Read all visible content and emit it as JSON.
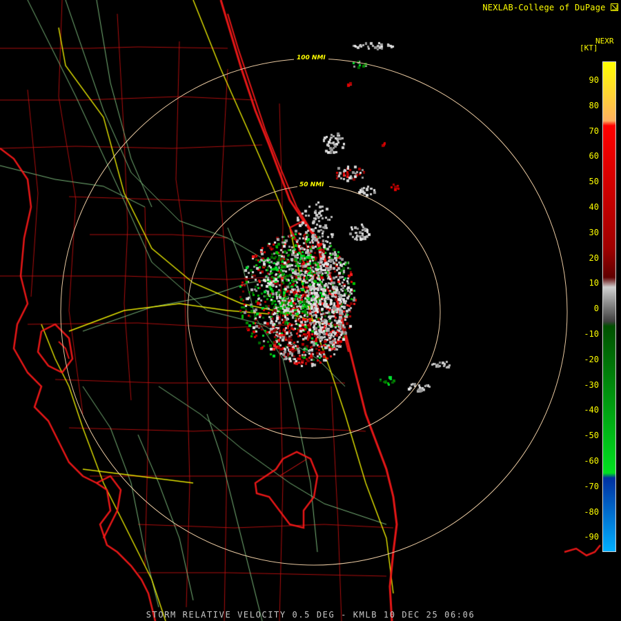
{
  "header": {
    "credit": "NEXLAB-College of DuPage",
    "logo_icon": "cod-logo-icon"
  },
  "legend": {
    "product_id": "NEXR",
    "unit": "[KT]",
    "ticks": [
      "90",
      "80",
      "70",
      "60",
      "50",
      "40",
      "30",
      "20",
      "10",
      "0",
      "-10",
      "-20",
      "-30",
      "-40",
      "-50",
      "-60",
      "-70",
      "-80",
      "-90"
    ],
    "gradient": [
      {
        "stop": 0.0,
        "color": "#ffff00"
      },
      {
        "stop": 0.12,
        "color": "#ffb060"
      },
      {
        "stop": 0.13,
        "color": "#ff0000"
      },
      {
        "stop": 0.38,
        "color": "#a00000"
      },
      {
        "stop": 0.44,
        "color": "#600000"
      },
      {
        "stop": 0.46,
        "color": "#d0d0d0"
      },
      {
        "stop": 0.53,
        "color": "#404040"
      },
      {
        "stop": 0.54,
        "color": "#005000"
      },
      {
        "stop": 0.84,
        "color": "#00e020"
      },
      {
        "stop": 0.85,
        "color": "#0030a0"
      },
      {
        "stop": 1.0,
        "color": "#00b0ff"
      }
    ]
  },
  "range_rings": [
    {
      "label": "100 NMI"
    },
    {
      "label": "50 NMI"
    }
  ],
  "product": {
    "label": "STORM RELATIVE VELOCITY 0.5 DEG - KMLB 10 DEC 25 06:06",
    "radar_site": "KMLB",
    "elevation": "0.5 DEG",
    "date": "10 DEC 25",
    "time": "06:06"
  },
  "colors": {
    "county_line": "#c01010",
    "coastline": "#ff1a1a",
    "highway": "#ffff00",
    "road": "#88cc88",
    "range_ring": "#e8c8a0"
  }
}
